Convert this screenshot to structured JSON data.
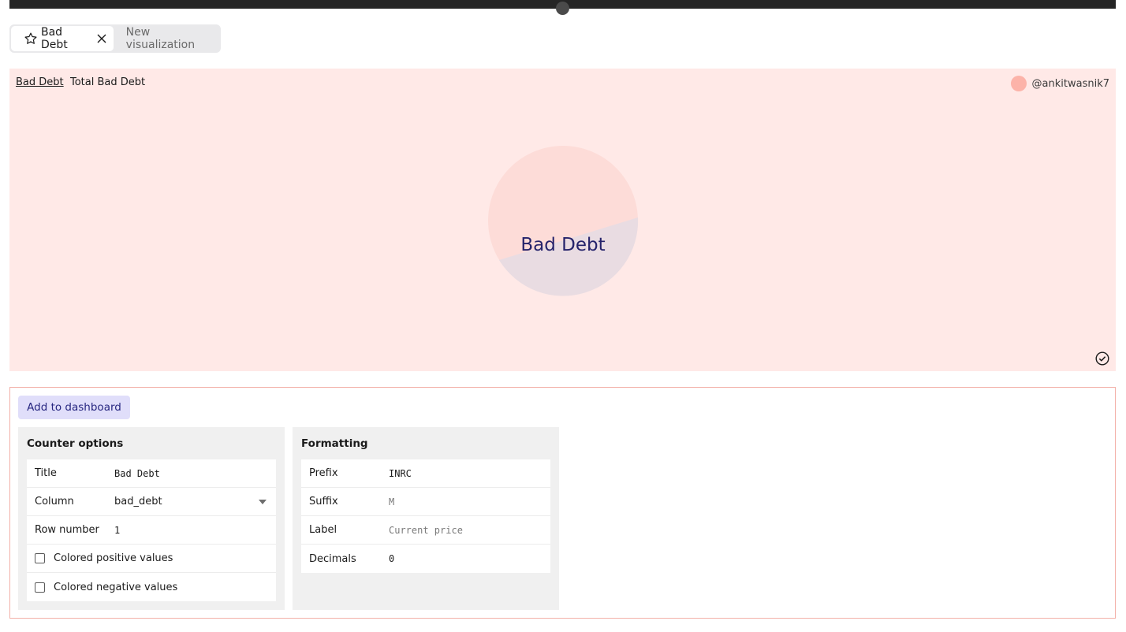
{
  "tabs": {
    "active_label": "Bad Debt",
    "new_label": "New visualization"
  },
  "viz": {
    "title_link": "Bad Debt",
    "subtitle": "Total Bad Debt",
    "user": "@ankitwasnik7",
    "counter_label": "Bad Debt",
    "colors": {
      "background": "#ffe9e7",
      "circle_main": "#fddcd8",
      "circle_lower": "#e9dce2",
      "text": "#25236b"
    }
  },
  "actions": {
    "add_to_dashboard": "Add to dashboard"
  },
  "counter_options": {
    "heading": "Counter options",
    "title_label": "Title",
    "title_value": "Bad Debt",
    "column_label": "Column",
    "column_value": "bad_debt",
    "row_number_label": "Row number",
    "row_number_value": "1",
    "colored_positive_label": "Colored positive values",
    "colored_negative_label": "Colored negative values"
  },
  "formatting": {
    "heading": "Formatting",
    "prefix_label": "Prefix",
    "prefix_value": "INRC",
    "suffix_label": "Suffix",
    "suffix_placeholder": "M",
    "label_label": "Label",
    "label_placeholder": "Current price",
    "decimals_label": "Decimals",
    "decimals_value": "0"
  }
}
